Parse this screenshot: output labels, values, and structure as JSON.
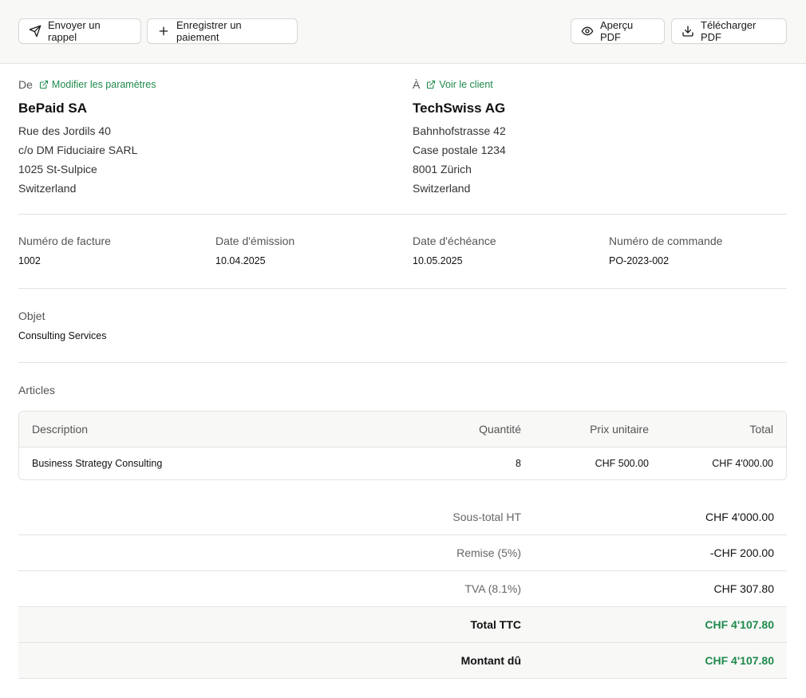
{
  "toolbar": {
    "send_reminder": "Envoyer un rappel",
    "record_payment": "Enregistrer un paiement",
    "preview_pdf": "Aperçu PDF",
    "download_pdf": "Télécharger PDF"
  },
  "from": {
    "label": "De",
    "link": "Modifier les paramètres",
    "name": "BePaid SA",
    "lines": [
      "Rue des Jordils 40",
      "c/o DM Fiduciaire SARL",
      "1025 St-Sulpice",
      "Switzerland"
    ]
  },
  "to": {
    "label": "À",
    "link": "Voir le client",
    "name": "TechSwiss AG",
    "lines": [
      "Bahnhofstrasse 42",
      "Case postale 1234",
      "8001 Zürich",
      "Switzerland"
    ]
  },
  "meta": {
    "invoice_number": {
      "label": "Numéro de facture",
      "value": "1002"
    },
    "issue_date": {
      "label": "Date d'émission",
      "value": "10.04.2025"
    },
    "due_date": {
      "label": "Date d'échéance",
      "value": "10.05.2025"
    },
    "order_number": {
      "label": "Numéro de commande",
      "value": "PO-2023-002"
    }
  },
  "subject": {
    "label": "Objet",
    "value": "Consulting Services"
  },
  "items": {
    "label": "Articles",
    "headers": {
      "description": "Description",
      "quantity": "Quantité",
      "unit_price": "Prix unitaire",
      "total": "Total"
    },
    "rows": [
      {
        "description": "Business Strategy Consulting",
        "quantity": "8",
        "unit_price": "CHF 500.00",
        "total": "CHF 4'000.00"
      }
    ]
  },
  "totals": {
    "subtotal": {
      "label": "Sous-total HT",
      "value": "CHF 4'000.00"
    },
    "discount": {
      "label": "Remise (5%)",
      "value": "-CHF 200.00"
    },
    "vat": {
      "label": "TVA (8.1%)",
      "value": "CHF 307.80"
    },
    "total": {
      "label": "Total TTC",
      "value": "CHF 4'107.80"
    },
    "amount_due": {
      "label": "Montant dû",
      "value": "CHF 4'107.80"
    }
  },
  "colors": {
    "accent": "#1f8a4c",
    "toolbar_bg": "#f8f8f7",
    "border": "#e3e3e0"
  },
  "icons": {
    "send_reminder": "send-icon",
    "record_payment": "plus-icon",
    "preview_pdf": "eye-icon",
    "download_pdf": "download-icon",
    "external_link": "external-link-icon"
  }
}
